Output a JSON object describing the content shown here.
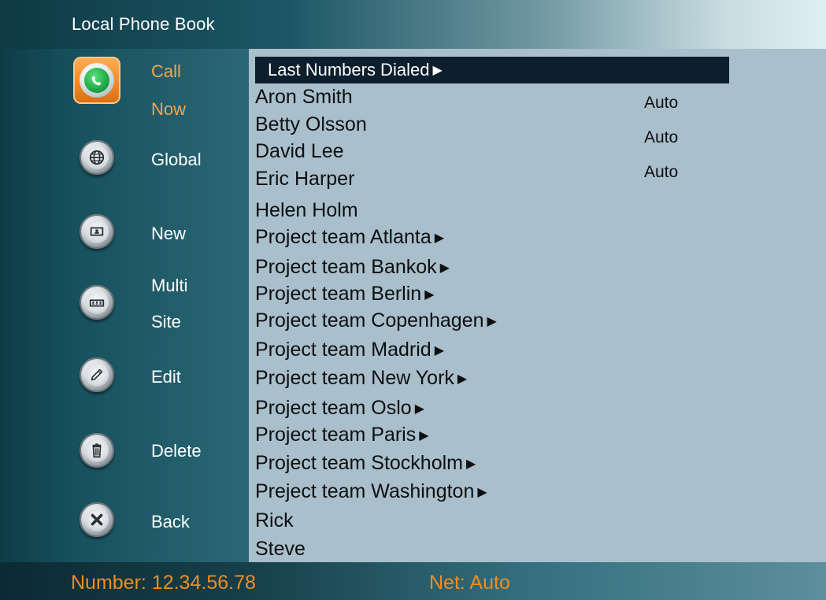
{
  "window": {
    "title": "Local Phone Book"
  },
  "sidebar": {
    "call": {
      "line1": "Call",
      "line2": "Now",
      "icon": "phone-icon"
    },
    "global": {
      "label": "Global",
      "icon": "globe-icon"
    },
    "new": {
      "label": "New",
      "icon": "contact-card-icon"
    },
    "multi": {
      "line1": "Multi",
      "line2": "Site",
      "icon": "multisite-icon"
    },
    "edit": {
      "label": "Edit",
      "icon": "pencil-icon"
    },
    "delete": {
      "label": "Delete",
      "icon": "trash-icon"
    },
    "back": {
      "label": "Back",
      "icon": "close-icon"
    }
  },
  "list": {
    "selected": "Last Numbers Dialed",
    "arrow": "▶",
    "entries": [
      "Aron Smith",
      "Betty Olsson",
      "David Lee",
      "Eric Harper",
      "Helen Holm",
      "Project team Atlanta",
      "Project team Bankok",
      "Project team Berlin",
      "Project team Copenhagen",
      "Project team Madrid",
      "Project team New York",
      "Project team Oslo",
      "Project team Paris",
      "Project team Stockholm",
      "Preject team Washington",
      "Rick",
      "Steve"
    ],
    "auto_values": [
      "Auto",
      "Auto",
      "Auto"
    ]
  },
  "status": {
    "number": "Number: 12.34.56.78",
    "net": "Net: Auto"
  },
  "colors": {
    "accent_orange": "#f08e1e",
    "panel_bg": "#a9bfcb",
    "highlight_bg": "#0d1f2c"
  }
}
